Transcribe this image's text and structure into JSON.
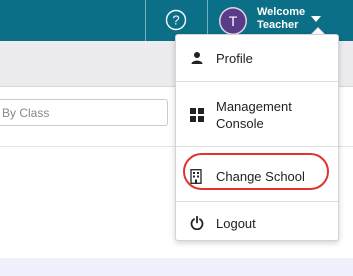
{
  "header": {
    "help_icon": "question-circle-icon",
    "avatar_initial": "T",
    "welcome_line1": "Welcome",
    "welcome_line2": "Teacher",
    "caret_icon": "caret-down-icon",
    "bar_color": "#0b6f87",
    "avatar_color": "#5a3b87"
  },
  "filter": {
    "placeholder": "By Class"
  },
  "menu": {
    "items": [
      {
        "label": "Profile",
        "icon": "user-icon"
      },
      {
        "label": "Management Console",
        "line1": "Management",
        "line2": "Console",
        "icon": "dashboard-grid-icon"
      },
      {
        "label": "Change School",
        "icon": "building-icon",
        "highlighted": true
      },
      {
        "label": "Logout",
        "icon": "power-icon"
      }
    ],
    "highlight_color": "#e0342b"
  }
}
